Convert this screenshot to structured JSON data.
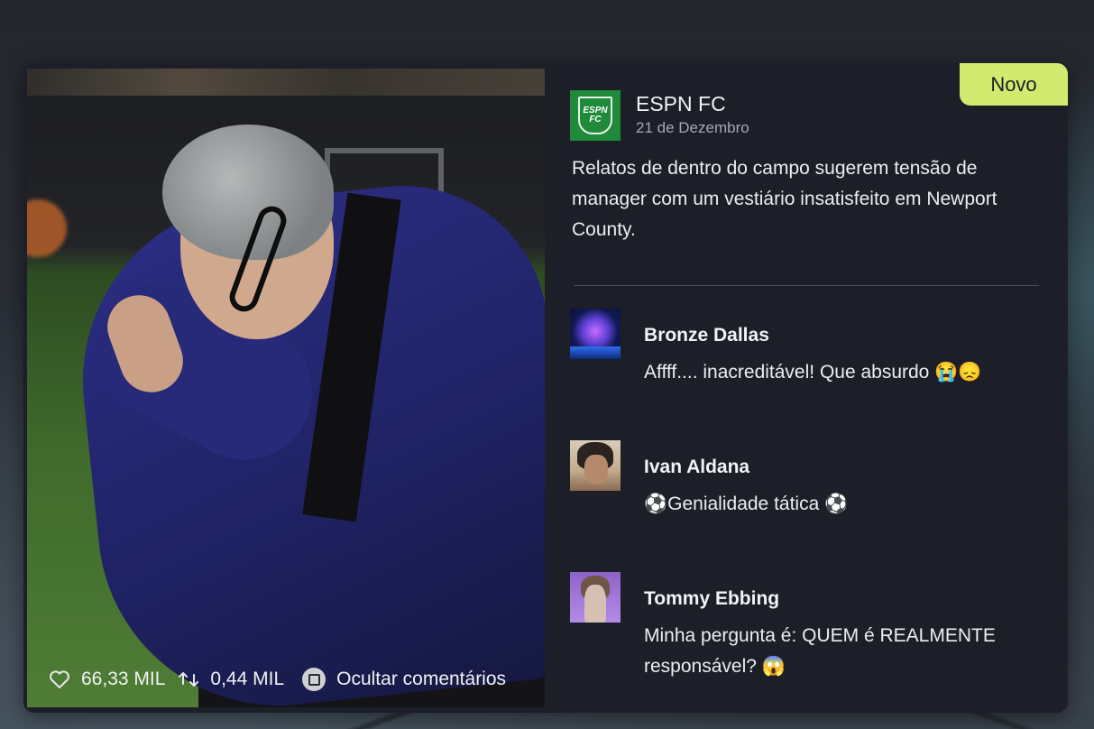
{
  "post": {
    "badge": "Novo",
    "source": {
      "name": "ESPN FC",
      "date": "21 de Dezembro",
      "logo_text": "ESPN FC"
    },
    "headline": "Relatos de dentro do campo sugerem tensão de manager com um vestiário insatisfeito em Newport County.",
    "stats": {
      "likes": "66,33 MIL",
      "reposts": "0,44 MIL",
      "hide_comments_label": "Ocultar comentários"
    }
  },
  "comments": [
    {
      "author": "Bronze Dallas",
      "text": "Affff.... inacreditável! Que absurdo 😭😞"
    },
    {
      "author": "Ivan Aldana",
      "text": "⚽Genialidade tática ⚽"
    },
    {
      "author": "Tommy Ebbing",
      "text": "Minha pergunta é: QUEM é REALMENTE responsável? 😱"
    }
  ],
  "colors": {
    "badge": "#d2ea6f",
    "card": "#1c1e28",
    "espn_green": "#1f8a3a"
  },
  "icons": [
    "heart-icon",
    "repost-icon",
    "square-button-icon"
  ]
}
